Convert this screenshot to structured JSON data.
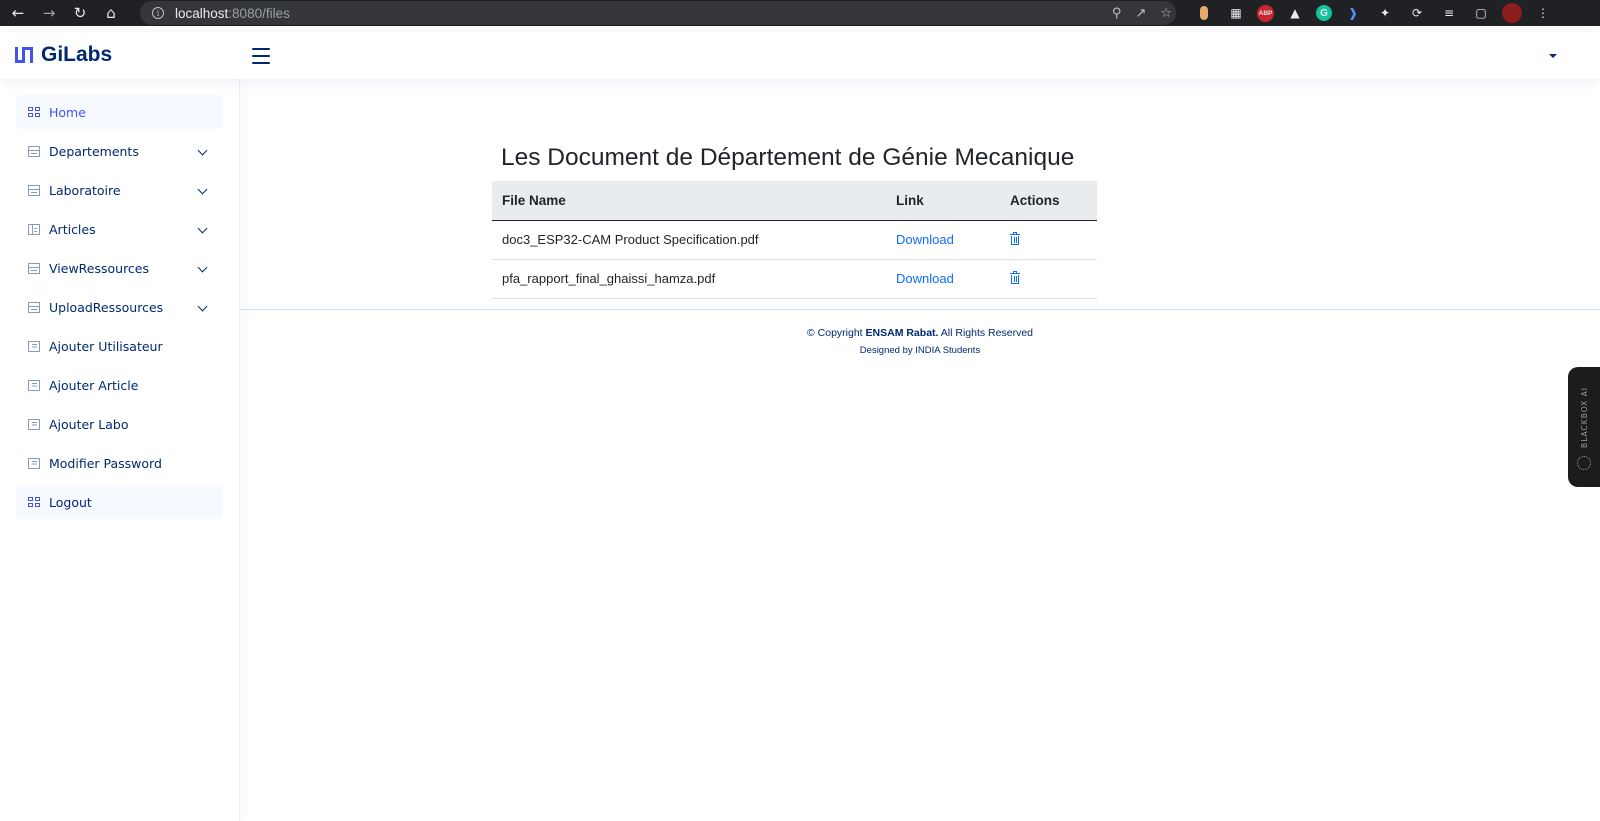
{
  "browser": {
    "url_host": "localhost",
    "url_path": ":8080/files",
    "ext_abp": "ABP",
    "ext_grammarly": "G"
  },
  "header": {
    "brand": "GiLabs"
  },
  "sidebar": {
    "items": [
      {
        "label": "Home",
        "icon": "grid-icon",
        "active": true,
        "expandable": false
      },
      {
        "label": "Departements",
        "icon": "layout-icon",
        "active": false,
        "expandable": true
      },
      {
        "label": "Laboratoire",
        "icon": "layout-icon",
        "active": false,
        "expandable": true
      },
      {
        "label": "Articles",
        "icon": "table-icon",
        "active": false,
        "expandable": true
      },
      {
        "label": "ViewRessources",
        "icon": "layout-icon",
        "active": false,
        "expandable": true
      },
      {
        "label": "UploadRessources",
        "icon": "layout-icon",
        "active": false,
        "expandable": true
      },
      {
        "label": "Ajouter Utilisateur",
        "icon": "list-icon",
        "active": false,
        "expandable": false
      },
      {
        "label": "Ajouter Article",
        "icon": "list-icon",
        "active": false,
        "expandable": false
      },
      {
        "label": "Ajouter Labo",
        "icon": "list-icon",
        "active": false,
        "expandable": false
      },
      {
        "label": "Modifier Password",
        "icon": "list-icon",
        "active": false,
        "expandable": false
      },
      {
        "label": "Logout",
        "icon": "grid-icon",
        "active": true,
        "expandable": false
      }
    ]
  },
  "main": {
    "title": "Les Document de Département de Génie Mecanique",
    "table": {
      "columns": [
        "File Name",
        "Link",
        "Actions"
      ],
      "rows": [
        {
          "file_name": "doc3_ESP32-CAM Product Specification.pdf",
          "link": "Download"
        },
        {
          "file_name": "pfa_rapport_final_ghaissi_hamza.pdf",
          "link": "Download"
        }
      ]
    }
  },
  "footer": {
    "copyright_prefix": "© Copyright ",
    "copyright_org": "ENSAM Rabat.",
    "copyright_suffix": " All Rights Reserved",
    "credits": "Designed by INDIA Students"
  },
  "widget": {
    "label": "BLACKBOX AI"
  },
  "colors": {
    "accent": "#4154f1",
    "nav_text": "#012970",
    "link": "#0d6efd",
    "chrome_bg": "#202124"
  }
}
